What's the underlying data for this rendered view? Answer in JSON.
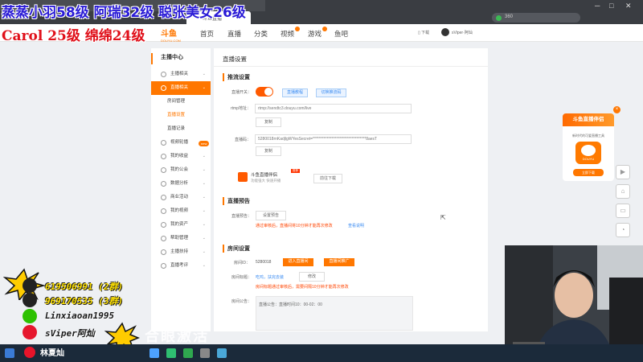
{
  "browser": {
    "tab_title": "斗鱼直播",
    "address": "360",
    "window_controls": [
      "─",
      "□",
      "✕"
    ]
  },
  "overlay": {
    "line1": "蒸蒸小羽58级 阿瑞32级 聪张美女26级",
    "line2": "Carol 25级  绵绵24级",
    "contacts": [
      {
        "icon": "qq-icon",
        "text": "619506991 (2群)",
        "color": "yellow"
      },
      {
        "icon": "qq-icon",
        "text": "969170535 (3群)",
        "color": "yellow"
      },
      {
        "icon": "wechat-icon",
        "text": "Linxiaoan1995",
        "color": "dark"
      },
      {
        "icon": "weibo-icon",
        "text": "sViper阿灿",
        "color": "dark"
      }
    ],
    "watermark": "合眼激活",
    "name_tag": "林夏灿"
  },
  "site": {
    "logo_main": "斗鱼",
    "logo_sub": "DOUYU.COM",
    "nav": [
      "首页",
      "直播",
      "分类",
      "视频",
      "游戏",
      "鱼吧"
    ],
    "download": "下载",
    "username": "sViper·阿灿"
  },
  "sidebar": {
    "title": "主播中心",
    "items": [
      {
        "label": "主播相关",
        "type": "item",
        "active": false
      },
      {
        "label": "直播相关",
        "type": "item",
        "active": true
      },
      {
        "label": "房间管理",
        "type": "sub",
        "on": false
      },
      {
        "label": "直播设置",
        "type": "sub",
        "on": true
      },
      {
        "label": "直播记录",
        "type": "sub",
        "on": false
      },
      {
        "label": "视频轮播",
        "type": "item",
        "active": false
      },
      {
        "label": "我的收益",
        "type": "item",
        "active": false
      },
      {
        "label": "我的公会",
        "type": "item",
        "active": false
      },
      {
        "label": "数据分析",
        "type": "item",
        "active": false
      },
      {
        "label": "商业活动",
        "type": "item",
        "active": false
      },
      {
        "label": "我的视频",
        "type": "item",
        "active": false
      },
      {
        "label": "我的资产",
        "type": "item",
        "active": false
      },
      {
        "label": "帮助管理",
        "type": "item",
        "active": false
      },
      {
        "label": "主播扶持",
        "type": "item",
        "active": false
      },
      {
        "label": "直播考评",
        "type": "item",
        "active": false
      }
    ],
    "new_badge": "new"
  },
  "main": {
    "title": "直播设置",
    "stream": {
      "section": "推流设置",
      "switch_label": "直播开关：",
      "btn_guide": "直播教程",
      "btn_code": "切换推流码",
      "rtmp_label": "rtmp地址：",
      "rtmp_value": "rtmp://sendtc3.douyu.com/live",
      "copy": "复制",
      "key_label": "直播码：",
      "key_value": "5280018rnKadjlgWYesSecret=**********************************8aesT",
      "promo_title": "斗鱼直播伴侣",
      "promo_sub": "功能强大 快速开播",
      "promo_hot": "推荐",
      "promo_btn": "前往下载"
    },
    "notice": {
      "section": "直播预告",
      "label": "直播预告：",
      "btn": "设置预告",
      "warn": "通过审核后，直播间将10分钟才能再次修改",
      "link": "查看说明"
    },
    "room": {
      "section": "房间设置",
      "id_label": "房间ID：",
      "id_value": "5280018",
      "btn_enter": "进入直播间",
      "btn_share": "直播间推广",
      "title_label": "房间标题：",
      "title_value": "吃鸡，扶完去装",
      "edit": "修改",
      "title_warn": "房间标题通过审核后，需要间隔10分钟才能再次修改",
      "notice_label": "房间公告：",
      "notice_value": "直播公告：直播时间10：00-02：00"
    }
  },
  "ad": {
    "title": "斗鱼直播伴侣",
    "sub": "新时代的可爱直播工具",
    "logo": "DOUYU",
    "btn": "立即下载",
    "close": "×"
  },
  "float_buttons": [
    "▶",
    "⌂",
    "▭",
    "◔"
  ]
}
